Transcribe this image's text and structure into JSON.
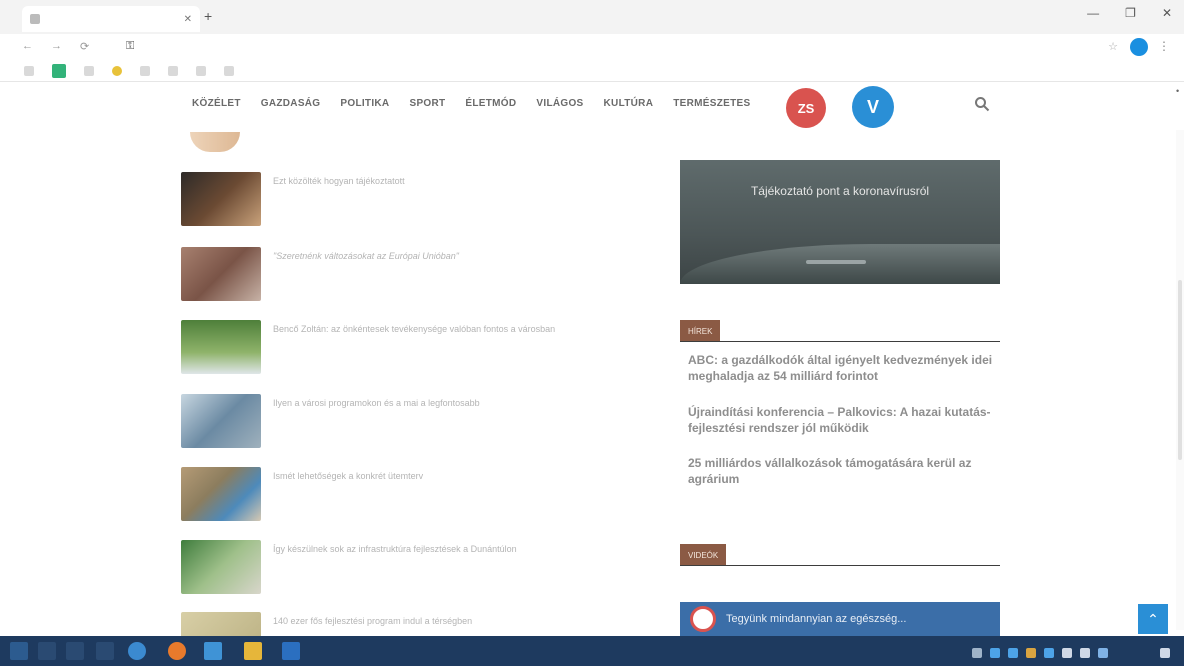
{
  "browser": {
    "tab_title": "",
    "url": "",
    "bookmarks": [
      "",
      "",
      "",
      "",
      "",
      "",
      "",
      ""
    ]
  },
  "site": {
    "nav": [
      "KÖZÉLET",
      "GAZDASÁG",
      "POLITIKA",
      "SPORT",
      "ÉLETMÓD",
      "VILÁGOS",
      "KULTÚRA",
      "TERMÉSZETES"
    ],
    "logo_red": "ZS",
    "logo_blue": "V"
  },
  "articles": [
    {
      "title": "Ezt közölték hogyan tájékoztatott"
    },
    {
      "title": "\"Szeretnénk változásokat az Európai Unióban\""
    },
    {
      "title": "Bencő Zoltán: az önkéntesek tevékenysége valóban fontos a városban"
    },
    {
      "title": "Ilyen a városi programokon és a mai a legfontosabb"
    },
    {
      "title": "Ismét lehetőségek a konkrét ütemterv"
    },
    {
      "title": "Így készülnek sok az infrastruktúra fejlesztések a Dunántúlon"
    },
    {
      "title": "140 ezer fős fejlesztési program indul a térségben"
    }
  ],
  "banner": {
    "title": "Tájékoztató pont a koronavírusról",
    "subtitle": ""
  },
  "section1": {
    "label": "HÍREK",
    "items": [
      "ABC: a gazdálkodók által igényelt kedvezmények idei meghaladja az 54 milliárd forintot",
      "Újraindítási konferencia – Palkovics: A hazai kutatás-fejlesztési rendszer jól működik",
      "25 milliárdos vállalkozások támogatására kerül az agrárium"
    ]
  },
  "section2": {
    "label": "VIDEÓK"
  },
  "fb": {
    "text": "Tegyünk mindannyian az egészség..."
  },
  "colors": {
    "accent_red": "#d9534f",
    "accent_blue": "#2a8fd6",
    "section_brown": "#8b5a44",
    "taskbar": "#1e3a5f"
  }
}
